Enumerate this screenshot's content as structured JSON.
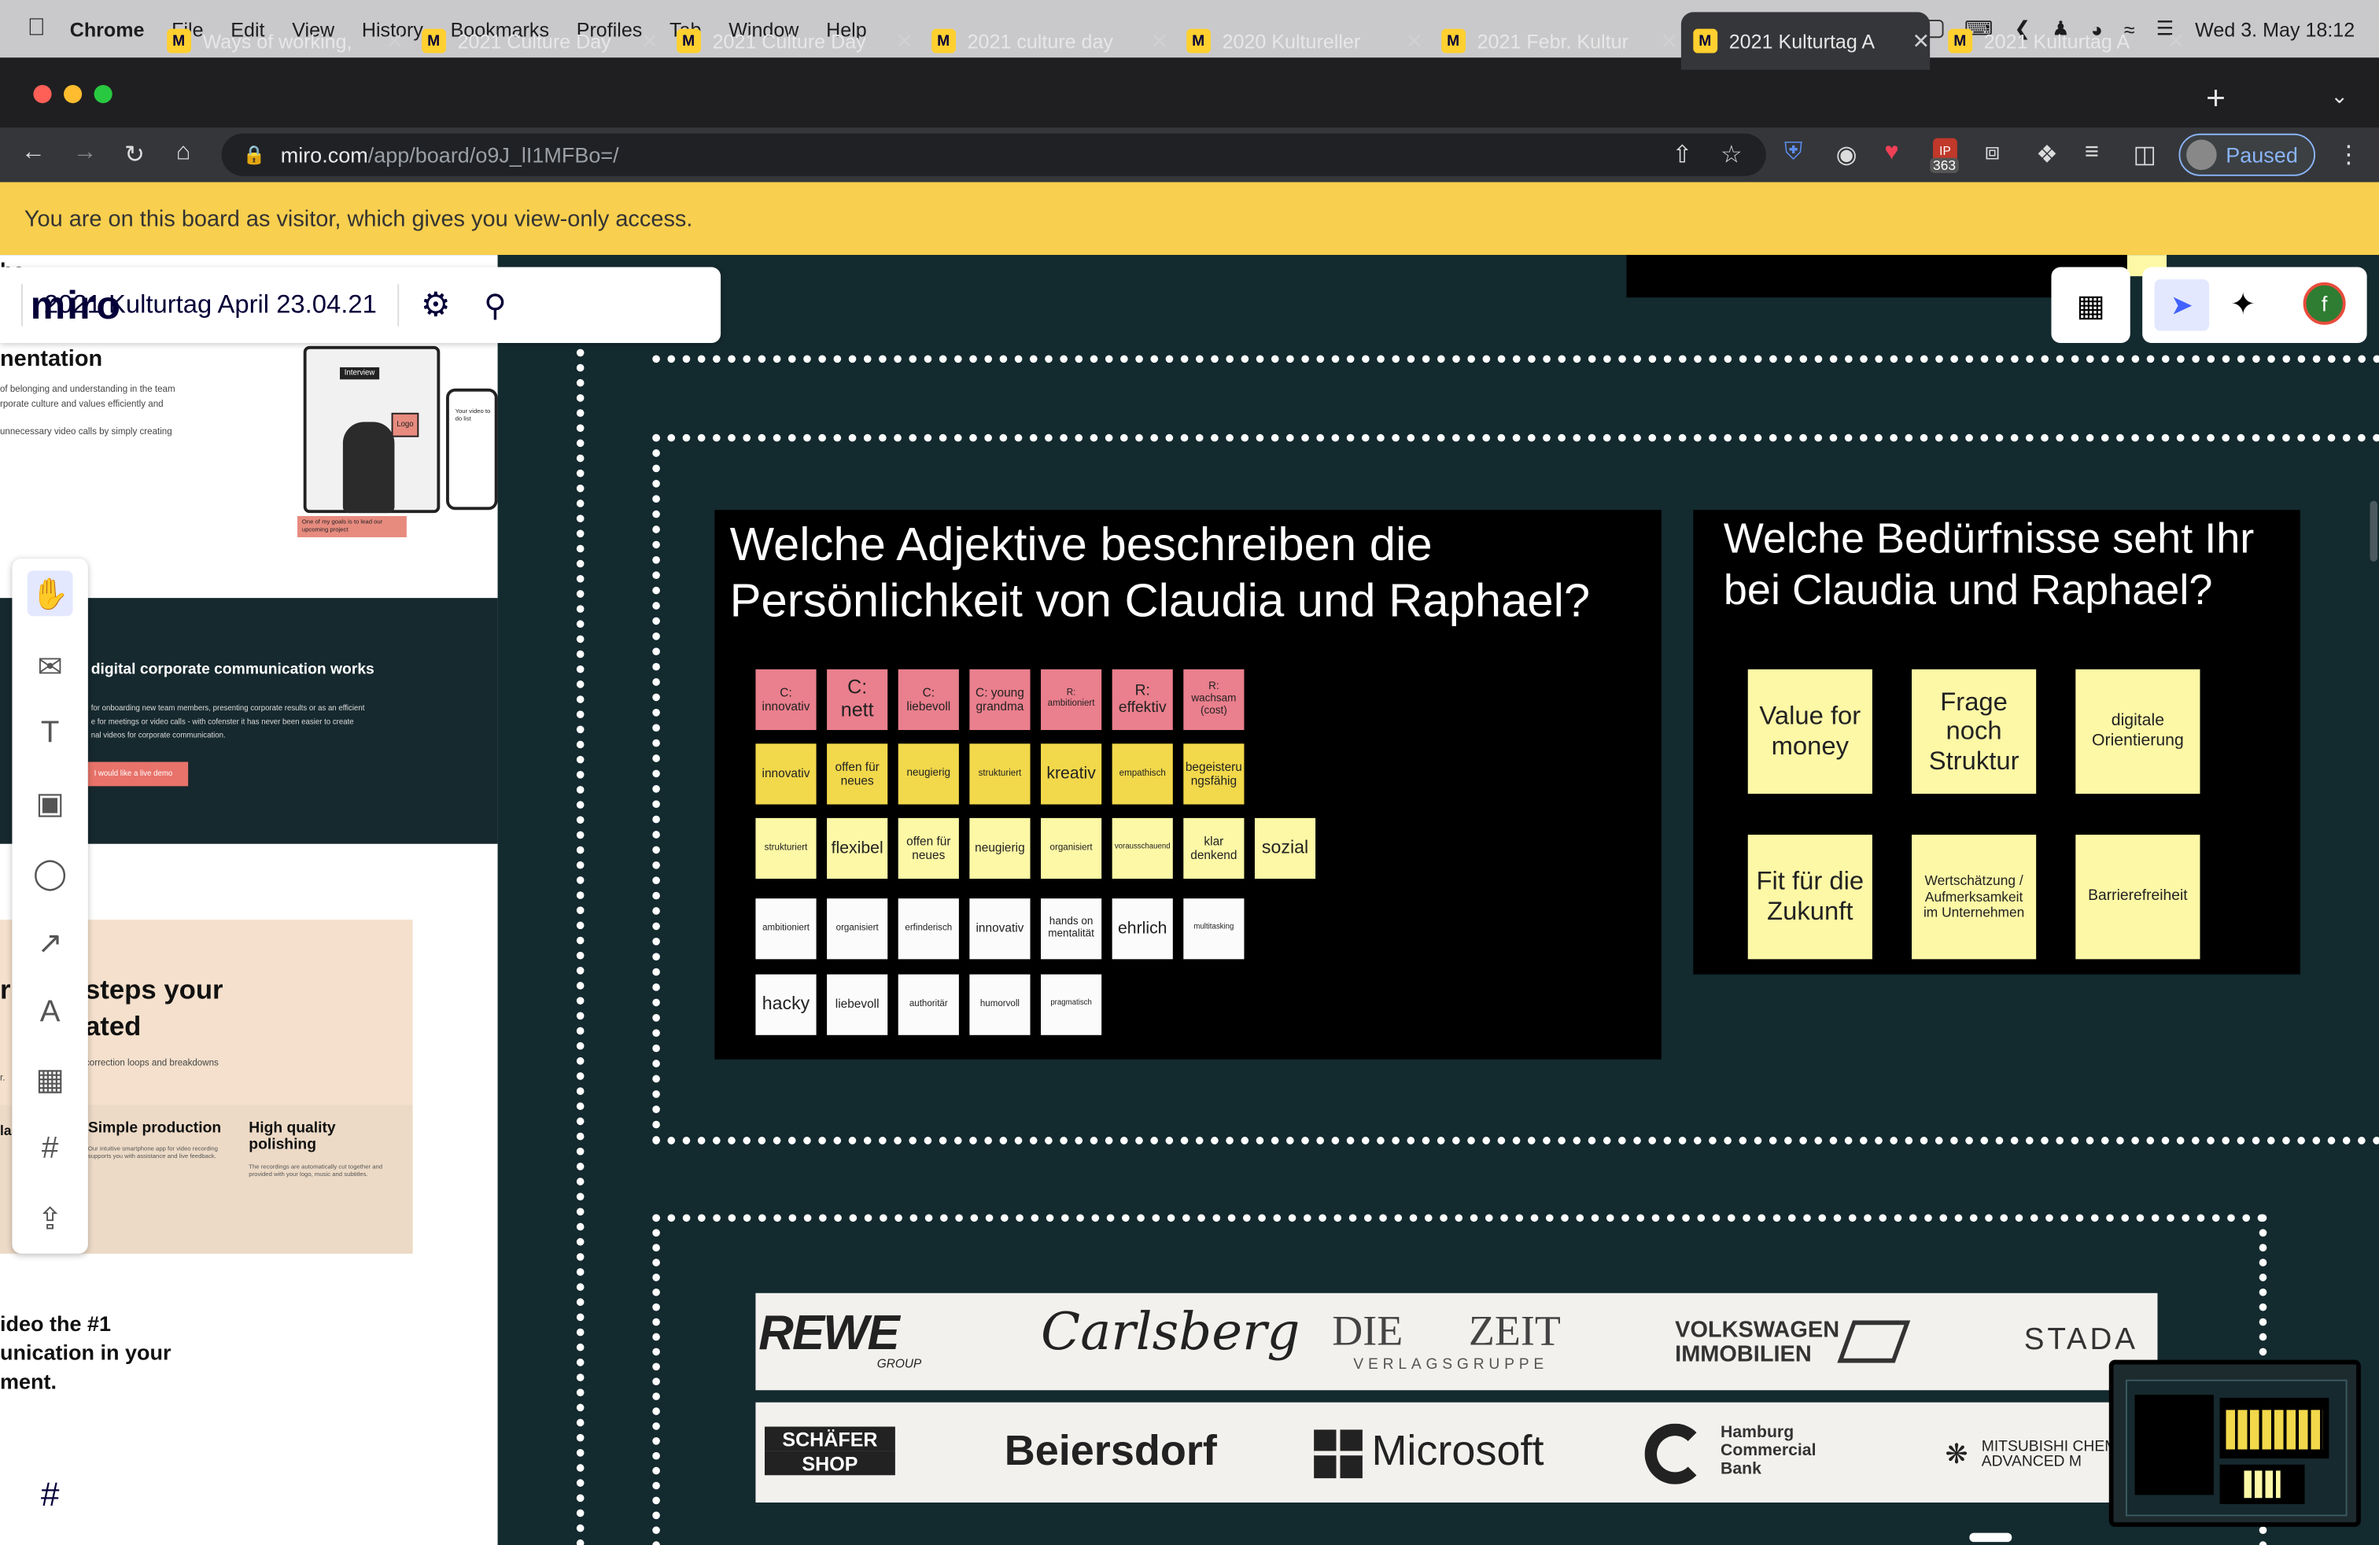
{
  "menubar": {
    "app": "Chrome",
    "items": [
      "File",
      "Edit",
      "View",
      "History",
      "Bookmarks",
      "Profiles",
      "Tab",
      "Window",
      "Help"
    ],
    "clock": "Wed 3. May  18:12"
  },
  "tabs": [
    {
      "title": "Ways of working,",
      "active": false
    },
    {
      "title": "2021 Culture Day",
      "active": false
    },
    {
      "title": "2021 Culture Day",
      "active": false
    },
    {
      "title": "2021 culture day",
      "active": false
    },
    {
      "title": "2020 Kultureller",
      "active": false
    },
    {
      "title": "2021 Febr. Kultur",
      "active": false
    },
    {
      "title": "2021 Kulturtag A",
      "active": true
    },
    {
      "title": "2021 Kulturtag A",
      "active": false
    }
  ],
  "address": {
    "host": "miro.com",
    "path": "/app/board/o9J_lI1MFBo=/"
  },
  "extensions": {
    "badge_top": "IP",
    "badge_count": "363"
  },
  "profile": {
    "label": "Paused"
  },
  "banner": {
    "text": "You are on this board as visitor, which gives you view-only access."
  },
  "miro": {
    "logo": "miro",
    "board_title": "2021 Kulturtag April 23.04.21",
    "avatar_letter": "f"
  },
  "webpage": {
    "cut_heading_top": "ha",
    "cut_heading_1": "ui",
    "cut_heading_2": "t",
    "heading": "nentation",
    "line1": "of belonging and understanding in the team",
    "line2": "rporate culture and values efficiently and",
    "line3": "unnecessary video calls by simply creating",
    "mock_chip": "Interview",
    "mock_logo": "Logo",
    "mock_todo": "Your video to do list",
    "mock_caption": "One of my goals is to lead our upcoming project",
    "section2_title": "digital corporate communication works",
    "section2_l1": "for onboarding new team members, presenting corporate results or as an efficient",
    "section2_l2": "e for meetings or video calls - with cofenster it has never been easier to create",
    "section2_l3": "nal videos for corporate communication.",
    "demo_button": "I would like a live demo",
    "steps_title_1": "steps your",
    "steps_title_2": "ated",
    "steps_prefix_1": "r",
    "steps_prefix_2": "i",
    "steps_sub_1": "correction loops and breakdowns",
    "steps_sub_2": "r.",
    "col1_title": "Simple production",
    "col1_text": "Our intuitive smartphone app for video recording supports you with assistance and live feedback.",
    "col2_title": "High quality polishing",
    "col2_text": "The recordings are automatically cut together and provided with your logo, music and subtitles.",
    "la": "la",
    "video_1": "ideo the #1",
    "video_2": "unication in your",
    "video_3": "ment."
  },
  "board1": {
    "title": "Welche Adjektive beschreiben die Persönlichkeit von Claudia und Raphael?",
    "rows": [
      [
        {
          "t": "C: innovativ",
          "c": "pink",
          "fs": 8
        },
        {
          "t": "C: nett",
          "c": "pink",
          "fs": 13
        },
        {
          "t": "C: liebevoll",
          "c": "pink",
          "fs": 8
        },
        {
          "t": "C: young grandma",
          "c": "pink",
          "fs": 8
        },
        {
          "t": "R: ambitioniert",
          "c": "pink",
          "fs": 6
        },
        {
          "t": "R: effektiv",
          "c": "pink",
          "fs": 10
        },
        {
          "t": "R: wachsam (cost)",
          "c": "pink",
          "fs": 7
        }
      ],
      [
        {
          "t": "innovativ",
          "c": "yel",
          "fs": 8
        },
        {
          "t": "offen für neues",
          "c": "yel",
          "fs": 8
        },
        {
          "t": "neugierig",
          "c": "yel",
          "fs": 7
        },
        {
          "t": "strukturiert",
          "c": "yel",
          "fs": 6
        },
        {
          "t": "kreativ",
          "c": "yel",
          "fs": 11
        },
        {
          "t": "empathisch",
          "c": "yel",
          "fs": 6
        },
        {
          "t": "begeisterungsfähig",
          "c": "yel",
          "fs": 8
        }
      ],
      [
        {
          "t": "strukturiert",
          "c": "lyel",
          "fs": 6
        },
        {
          "t": "flexibel",
          "c": "lyel",
          "fs": 11
        },
        {
          "t": "offen für neues",
          "c": "lyel",
          "fs": 8
        },
        {
          "t": "neugierig",
          "c": "lyel",
          "fs": 8
        },
        {
          "t": "organisiert",
          "c": "lyel",
          "fs": 6
        },
        {
          "t": "vorausschauend",
          "c": "lyel",
          "fs": 5
        },
        {
          "t": "klar denkend",
          "c": "lyel",
          "fs": 8
        },
        {
          "t": "sozial",
          "c": "lyel",
          "fs": 12
        }
      ],
      [
        {
          "t": "ambitioniert",
          "c": "wht",
          "fs": 6
        },
        {
          "t": "organisiert",
          "c": "wht",
          "fs": 6
        },
        {
          "t": "erfinderisch",
          "c": "wht",
          "fs": 6
        },
        {
          "t": "innovativ",
          "c": "wht",
          "fs": 8
        },
        {
          "t": "hands on mentalität",
          "c": "wht",
          "fs": 7
        },
        {
          "t": "ehrlich",
          "c": "wht",
          "fs": 11
        },
        {
          "t": "multitasking",
          "c": "wht",
          "fs": 5
        }
      ],
      [
        {
          "t": "hacky",
          "c": "wht",
          "fs": 12
        },
        {
          "t": "liebevoll",
          "c": "wht",
          "fs": 8
        },
        {
          "t": "authoritär",
          "c": "wht",
          "fs": 6
        },
        {
          "t": "humorvoll",
          "c": "wht",
          "fs": 6
        },
        {
          "t": "pragmatisch",
          "c": "wht",
          "fs": 5
        }
      ]
    ]
  },
  "board2": {
    "title": "Welche Bedürfnisse seht Ihr bei Claudia und Raphael?",
    "notes": [
      {
        "t": "Value for money",
        "fs": 17
      },
      {
        "t": "Frage noch Struktur",
        "fs": 17
      },
      {
        "t": "digitale Orientierung",
        "fs": 11
      },
      {
        "t": "Fit für die Zukunft",
        "fs": 17
      },
      {
        "t": "Wertschätzung / Aufmerksamkeit im Unternehmen",
        "fs": 9
      },
      {
        "t": "Barrierefreiheit",
        "fs": 10
      }
    ]
  },
  "logos": {
    "row1": [
      "REWE",
      "GROUP",
      "Carlsberg",
      "DIE",
      "ZEIT",
      "VERLAGSGRUPPE",
      "VOLKSWAGEN",
      "IMMOBILIEN",
      "STADA"
    ],
    "row2": [
      "SCHÄFER",
      "SHOP",
      "Beiersdorf",
      "Microsoft",
      "Hamburg",
      "Commercial",
      "Bank",
      "MITSUBISHI CHEM",
      "ADVANCED M"
    ]
  }
}
